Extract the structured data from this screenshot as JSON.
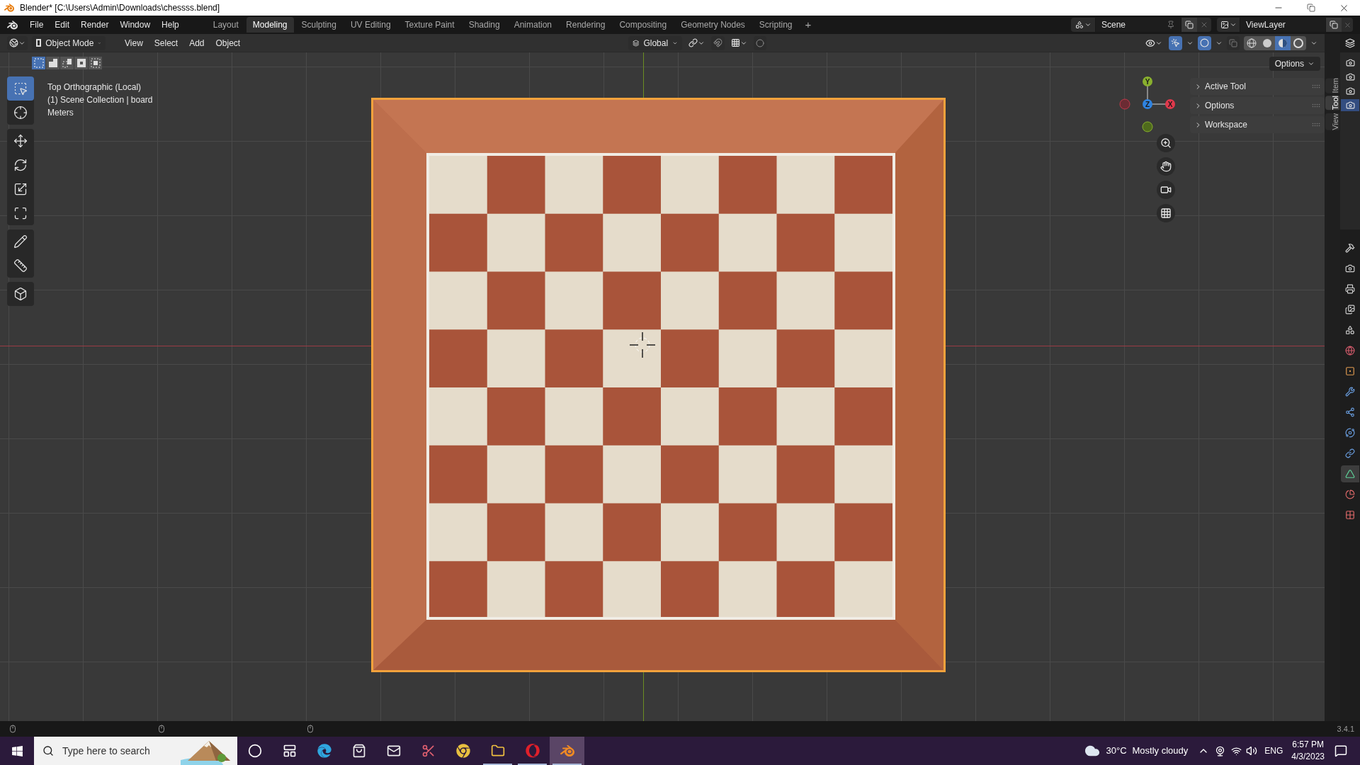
{
  "window": {
    "title": "Blender* [C:\\Users\\Admin\\Downloads\\chessss.blend]"
  },
  "menu": [
    "File",
    "Edit",
    "Render",
    "Window",
    "Help"
  ],
  "workspaces": [
    {
      "label": "Layout",
      "selected": false
    },
    {
      "label": "Modeling",
      "selected": true
    },
    {
      "label": "Sculpting",
      "selected": false
    },
    {
      "label": "UV Editing",
      "selected": false
    },
    {
      "label": "Texture Paint",
      "selected": false
    },
    {
      "label": "Shading",
      "selected": false
    },
    {
      "label": "Animation",
      "selected": false
    },
    {
      "label": "Rendering",
      "selected": false
    },
    {
      "label": "Compositing",
      "selected": false
    },
    {
      "label": "Geometry Nodes",
      "selected": false
    },
    {
      "label": "Scripting",
      "selected": false
    }
  ],
  "add_workspace": "+",
  "scene": {
    "name": "Scene"
  },
  "view_layer": {
    "name": "ViewLayer"
  },
  "header": {
    "mode": "Object Mode",
    "menus": [
      "View",
      "Select",
      "Add",
      "Object"
    ],
    "orientation": "Global",
    "options": "Options"
  },
  "select_modes": [
    {
      "selected": true
    },
    {
      "selected": false
    },
    {
      "selected": false
    },
    {
      "selected": false
    },
    {
      "selected": false
    }
  ],
  "tools": [
    [
      {
        "kind": "select",
        "selected": true
      },
      {
        "kind": "cursor",
        "selected": false
      }
    ],
    [
      {
        "kind": "move",
        "selected": false
      },
      {
        "kind": "rotate",
        "selected": false
      },
      {
        "kind": "scale",
        "selected": false
      },
      {
        "kind": "transform",
        "selected": false
      }
    ],
    [
      {
        "kind": "annotate",
        "selected": false
      },
      {
        "kind": "measure",
        "selected": false
      }
    ],
    [
      {
        "kind": "add_cube",
        "selected": false
      }
    ]
  ],
  "overlay_text": [
    "Top Orthographic (Local)",
    "(1) Scene Collection | board",
    "Meters"
  ],
  "gizmo": {
    "y": "Y",
    "z": "Z",
    "x": "X"
  },
  "npanel": {
    "sections": [
      "Active Tool",
      "Options",
      "Workspace"
    ],
    "tabs": [
      {
        "label": "Item",
        "selected": false
      },
      {
        "label": "Tool",
        "selected": true
      },
      {
        "label": "View",
        "selected": false
      }
    ]
  },
  "viewport_toggles": {
    "gizmos": true,
    "overlays": true
  },
  "shading_modes": [
    {
      "kind": "wireframe",
      "selected": false
    },
    {
      "kind": "solid",
      "selected": false
    },
    {
      "kind": "material",
      "selected": true
    },
    {
      "kind": "rendered",
      "selected": false
    }
  ],
  "outliner_items": [
    {
      "selected": false
    },
    {
      "selected": false
    },
    {
      "selected": false
    },
    {
      "selected": true
    }
  ],
  "properties_tabs": [
    {
      "kind": "tool",
      "selected": false
    },
    {
      "kind": "render",
      "selected": false
    },
    {
      "kind": "output",
      "selected": false
    },
    {
      "kind": "view_layer",
      "selected": false
    },
    {
      "kind": "scene",
      "selected": false
    },
    {
      "kind": "world",
      "selected": false
    },
    {
      "kind": "object",
      "selected": false
    },
    {
      "kind": "modifiers",
      "selected": false
    },
    {
      "kind": "particles",
      "selected": false
    },
    {
      "kind": "physics",
      "selected": false
    },
    {
      "kind": "constraints",
      "selected": false
    },
    {
      "kind": "data",
      "selected": true
    },
    {
      "kind": "material",
      "selected": false
    },
    {
      "kind": "texture",
      "selected": false
    }
  ],
  "status_bar": {
    "version": "3.4.1"
  },
  "taskbar": {
    "search_placeholder": "Type here to search",
    "apps": [
      {
        "kind": "cortana",
        "running": false,
        "active": false
      },
      {
        "kind": "task_view",
        "running": false,
        "active": false
      },
      {
        "kind": "edge",
        "running": false,
        "active": false
      },
      {
        "kind": "store",
        "running": false,
        "active": false
      },
      {
        "kind": "mail",
        "running": false,
        "active": false
      },
      {
        "kind": "snip",
        "running": false,
        "active": false
      },
      {
        "kind": "chrome",
        "running": false,
        "active": false
      },
      {
        "kind": "explorer",
        "running": true,
        "active": false
      },
      {
        "kind": "opera",
        "running": true,
        "active": false
      },
      {
        "kind": "blender",
        "running": true,
        "active": true
      }
    ],
    "weather": {
      "temperature": "30°C",
      "condition": "Mostly cloudy"
    },
    "language": "ENG",
    "time": "6:57 PM",
    "date": "4/3/2023"
  }
}
